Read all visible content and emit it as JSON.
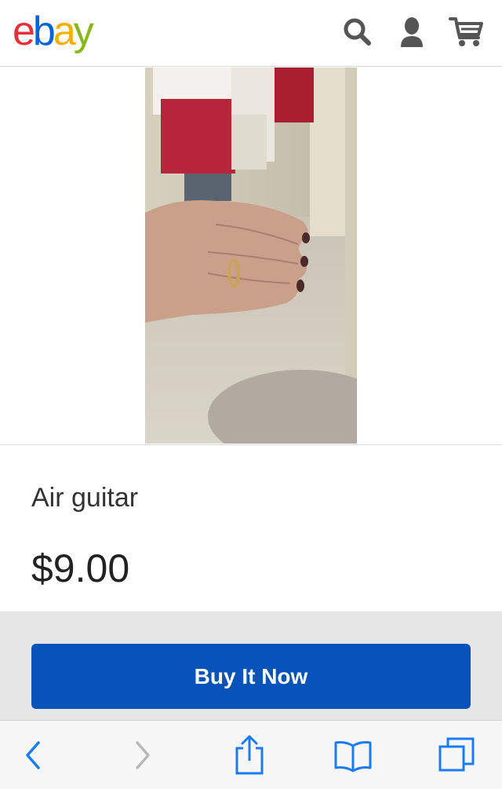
{
  "header": {
    "logo_letters": [
      "e",
      "b",
      "a",
      "y"
    ],
    "logo_colors": [
      "#e53238",
      "#0064d2",
      "#f5af02",
      "#86b817"
    ],
    "icons": [
      "search-icon",
      "user-icon",
      "cart-icon"
    ]
  },
  "listing": {
    "photo_description_icon": "product-photo",
    "title": "Air guitar",
    "price": "$9.00",
    "buy_label": "Buy It Now",
    "buy_color": "#0654ba"
  },
  "browser_toolbar": {
    "icons": [
      "back-icon",
      "forward-icon",
      "share-icon",
      "bookmarks-icon",
      "tabs-icon"
    ],
    "accent": "#1a7cf5"
  }
}
